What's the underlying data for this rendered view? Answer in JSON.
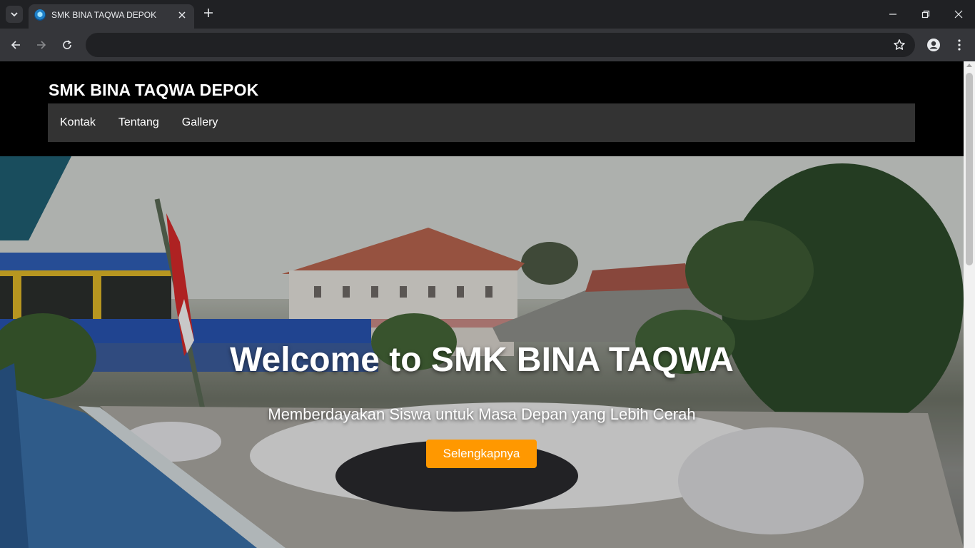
{
  "browser": {
    "tab_title": "SMK BINA TAQWA DEPOK",
    "address_value": "",
    "icons": {
      "tab_search": "chevron-down-icon",
      "favicon": "school-logo-icon",
      "tab_close": "close-icon",
      "new_tab": "plus-icon",
      "minimize": "minimize-icon",
      "restore": "restore-icon",
      "close": "close-icon",
      "back": "arrow-left-icon",
      "forward": "arrow-right-icon",
      "reload": "reload-icon",
      "bookmark": "star-icon",
      "profile": "profile-icon",
      "menu": "more-vert-icon"
    }
  },
  "site": {
    "title": "SMK BINA TAQWA DEPOK",
    "nav": [
      "Kontak",
      "Tentang",
      "Gallery"
    ]
  },
  "hero": {
    "title": "Welcome to SMK BINA TAQWA",
    "subtitle": "Memberdayakan Siswa untuk Masa Depan yang Lebih Cerah",
    "button_label": "Selengkapnya",
    "button_color": "#ff9800"
  }
}
